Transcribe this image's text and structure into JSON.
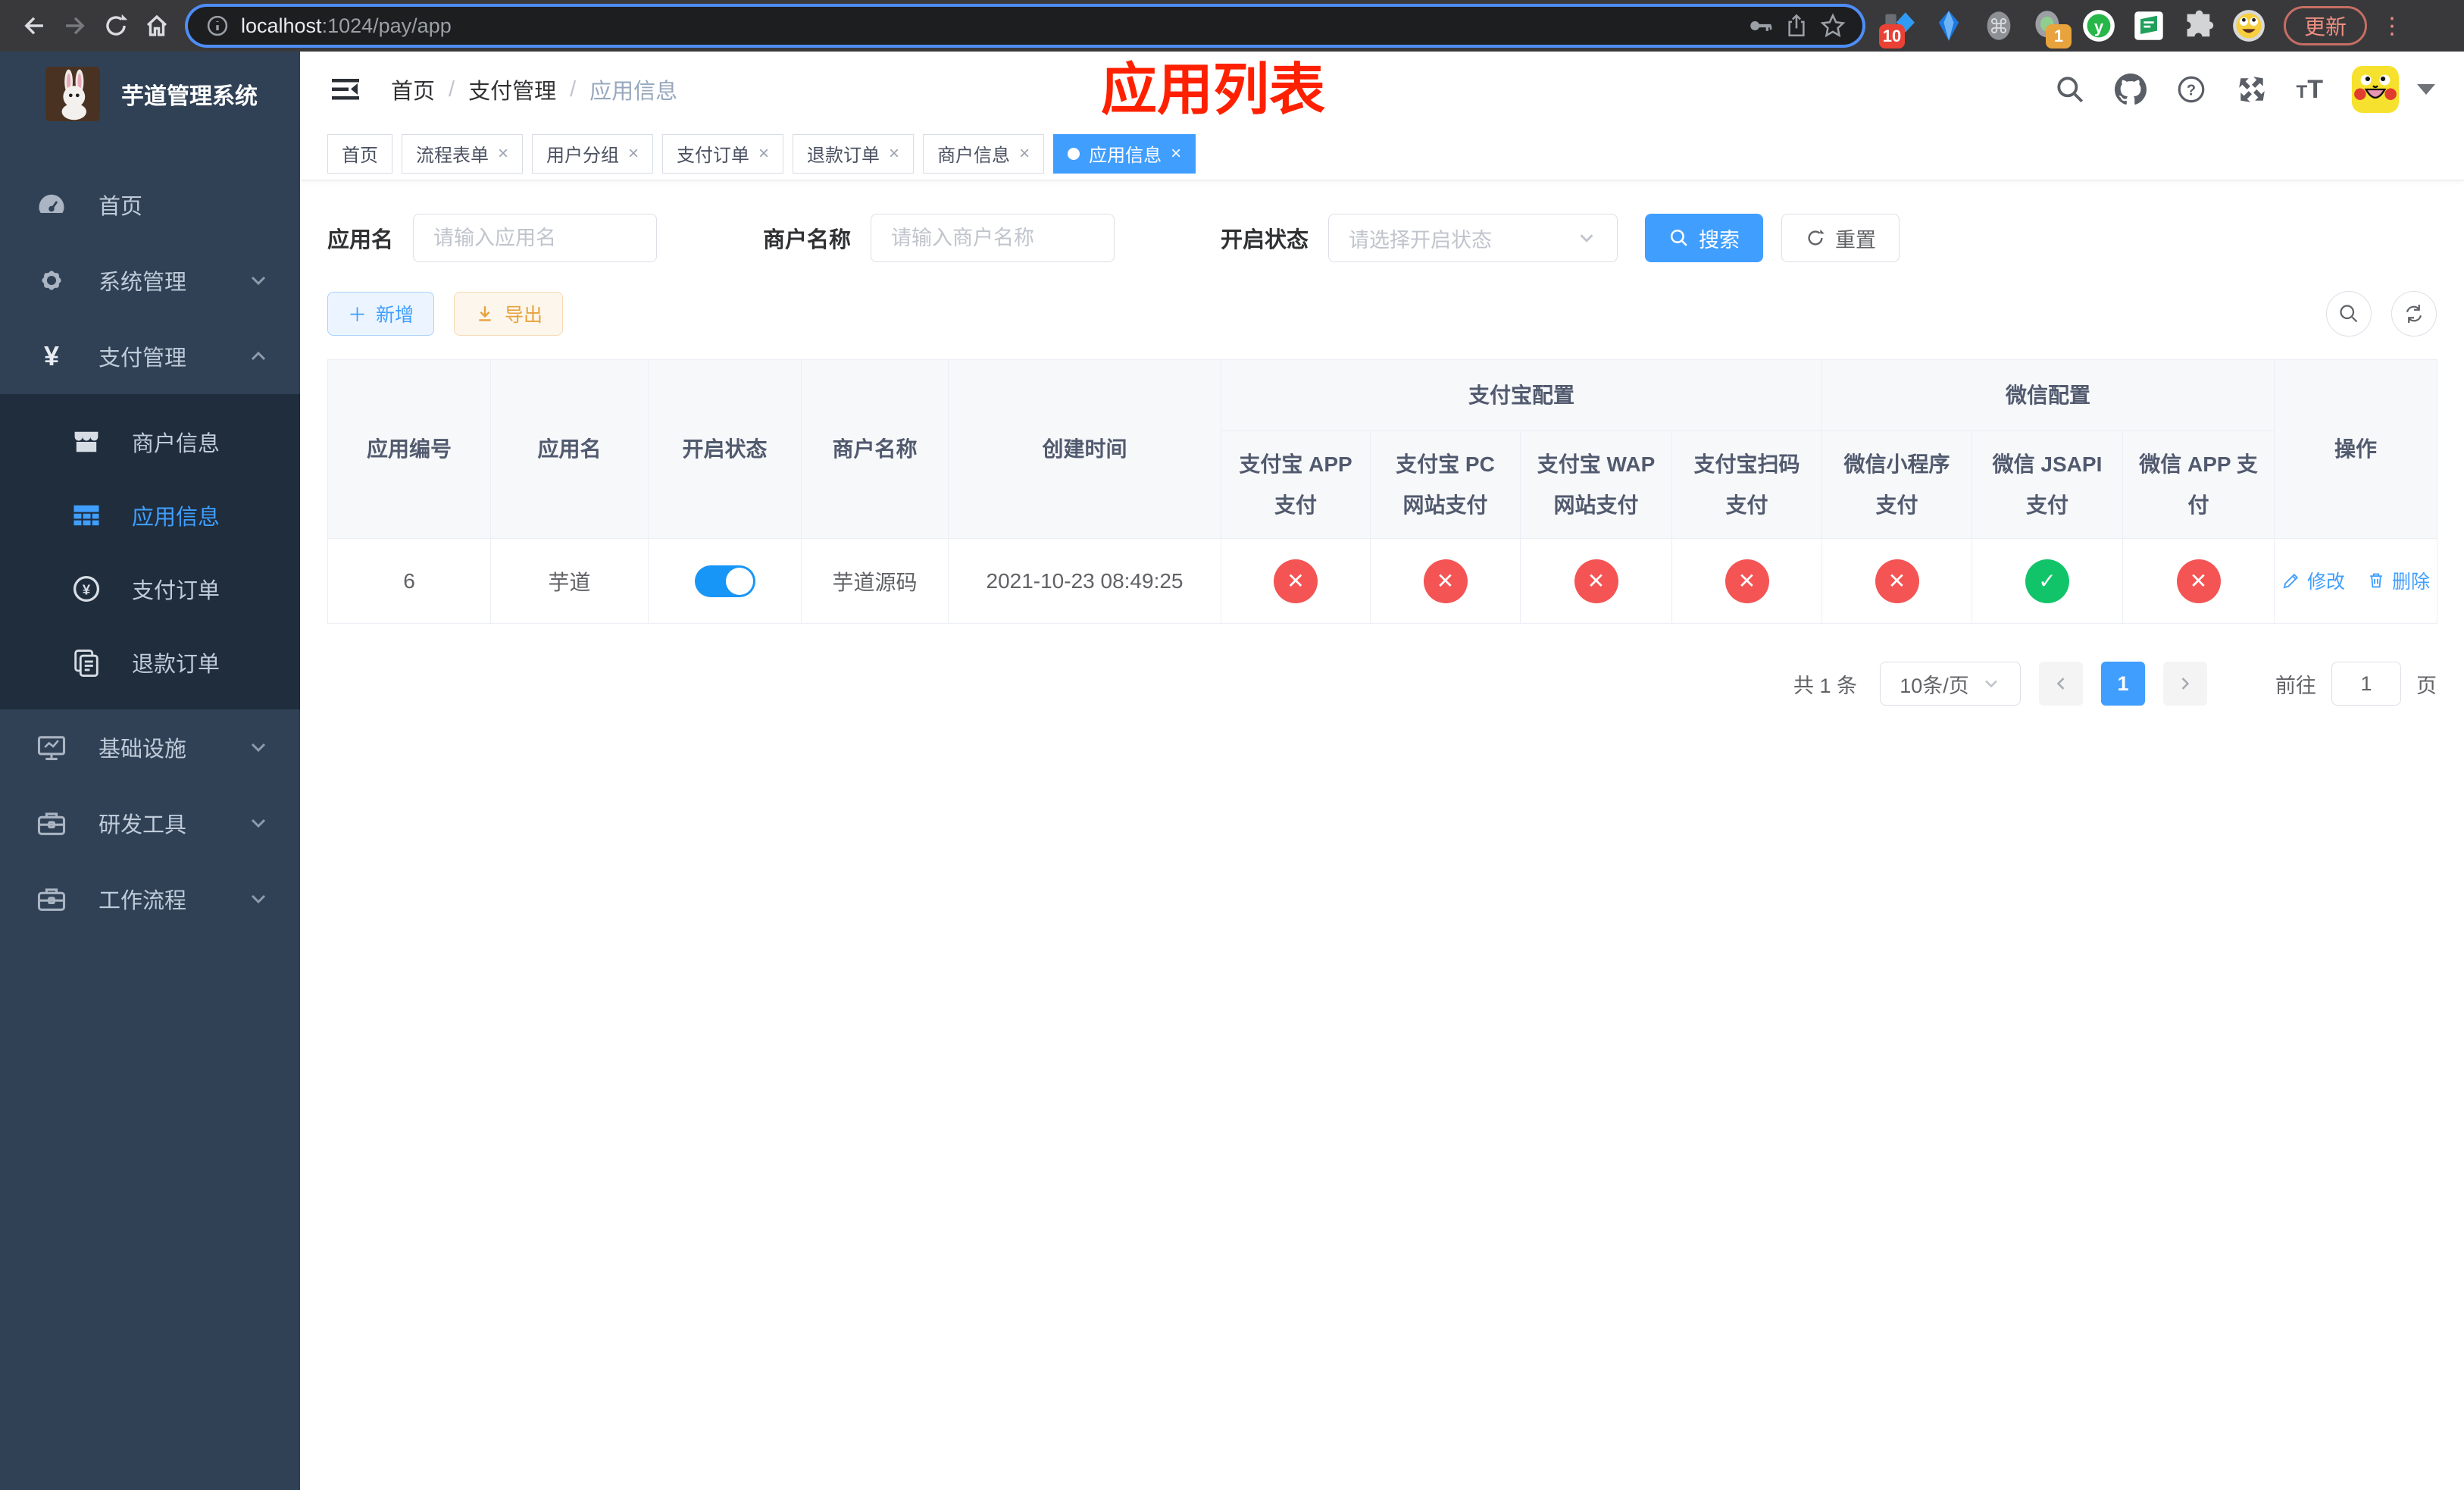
{
  "browser": {
    "url_host": "localhost",
    "url_rest": ":1024/pay/app",
    "ext_badge_blue": "10",
    "ext_badge_green": "1",
    "update_button": "更新",
    "kebab_glyph": "⋮"
  },
  "sidebar": {
    "title": "芋道管理系统",
    "home": "首页",
    "system": "系统管理",
    "payment": "支付管理",
    "merchant_info": "商户信息",
    "app_info": "应用信息",
    "pay_order": "支付订单",
    "refund_order": "退款订单",
    "infra": "基础设施",
    "dev_tools": "研发工具",
    "workflow": "工作流程"
  },
  "header": {
    "breadcrumb": [
      "首页",
      "支付管理",
      "应用信息"
    ],
    "separator": "/",
    "annotation": "应用列表",
    "tt_large": "T",
    "tt_small": "T"
  },
  "tabs": [
    {
      "label": "首页"
    },
    {
      "label": "流程表单"
    },
    {
      "label": "用户分组"
    },
    {
      "label": "支付订单"
    },
    {
      "label": "退款订单"
    },
    {
      "label": "商户信息"
    },
    {
      "label": "应用信息"
    }
  ],
  "ui": {
    "close_glyph": "×",
    "plus_glyph": "＋"
  },
  "filters": {
    "app_name_label": "应用名",
    "app_name_placeholder": "请输入应用名",
    "merchant_label": "商户名称",
    "merchant_placeholder": "请输入商户名称",
    "status_label": "开启状态",
    "status_placeholder": "请选择开启状态",
    "search_button": "搜索",
    "reset_button": "重置"
  },
  "toolbar": {
    "add_button": "新增",
    "export_button": "导出"
  },
  "table": {
    "groups": {
      "alipay": "支付宝配置",
      "wechat": "微信配置"
    },
    "columns": {
      "app_id": "应用编号",
      "app_name": "应用名",
      "status": "开启状态",
      "merchant": "商户名称",
      "created": "创建时间",
      "alipay_app": "支付宝 APP 支付",
      "alipay_pc": "支付宝 PC 网站支付",
      "alipay_wap": "支付宝 WAP 网站支付",
      "alipay_qr": "支付宝扫码支付",
      "wx_lite": "微信小程序支付",
      "wx_jsapi": "微信 JSAPI 支付",
      "wx_app": "微信 APP 支付",
      "actions": "操作"
    },
    "row": {
      "app_id": "6",
      "app_name": "芋道",
      "switch_state": "on",
      "merchant": "芋道源码",
      "created": "2021-10-23 08:49:25",
      "configs": [
        "cross",
        "cross",
        "cross",
        "cross",
        "cross",
        "check",
        "cross"
      ],
      "edit": "修改",
      "delete": "删除"
    }
  },
  "pagination": {
    "total": "共 1 条",
    "page_size": "10条/页",
    "current_page": "1",
    "goto_label": "前往",
    "goto_value": "1",
    "page_suffix": "页"
  }
}
